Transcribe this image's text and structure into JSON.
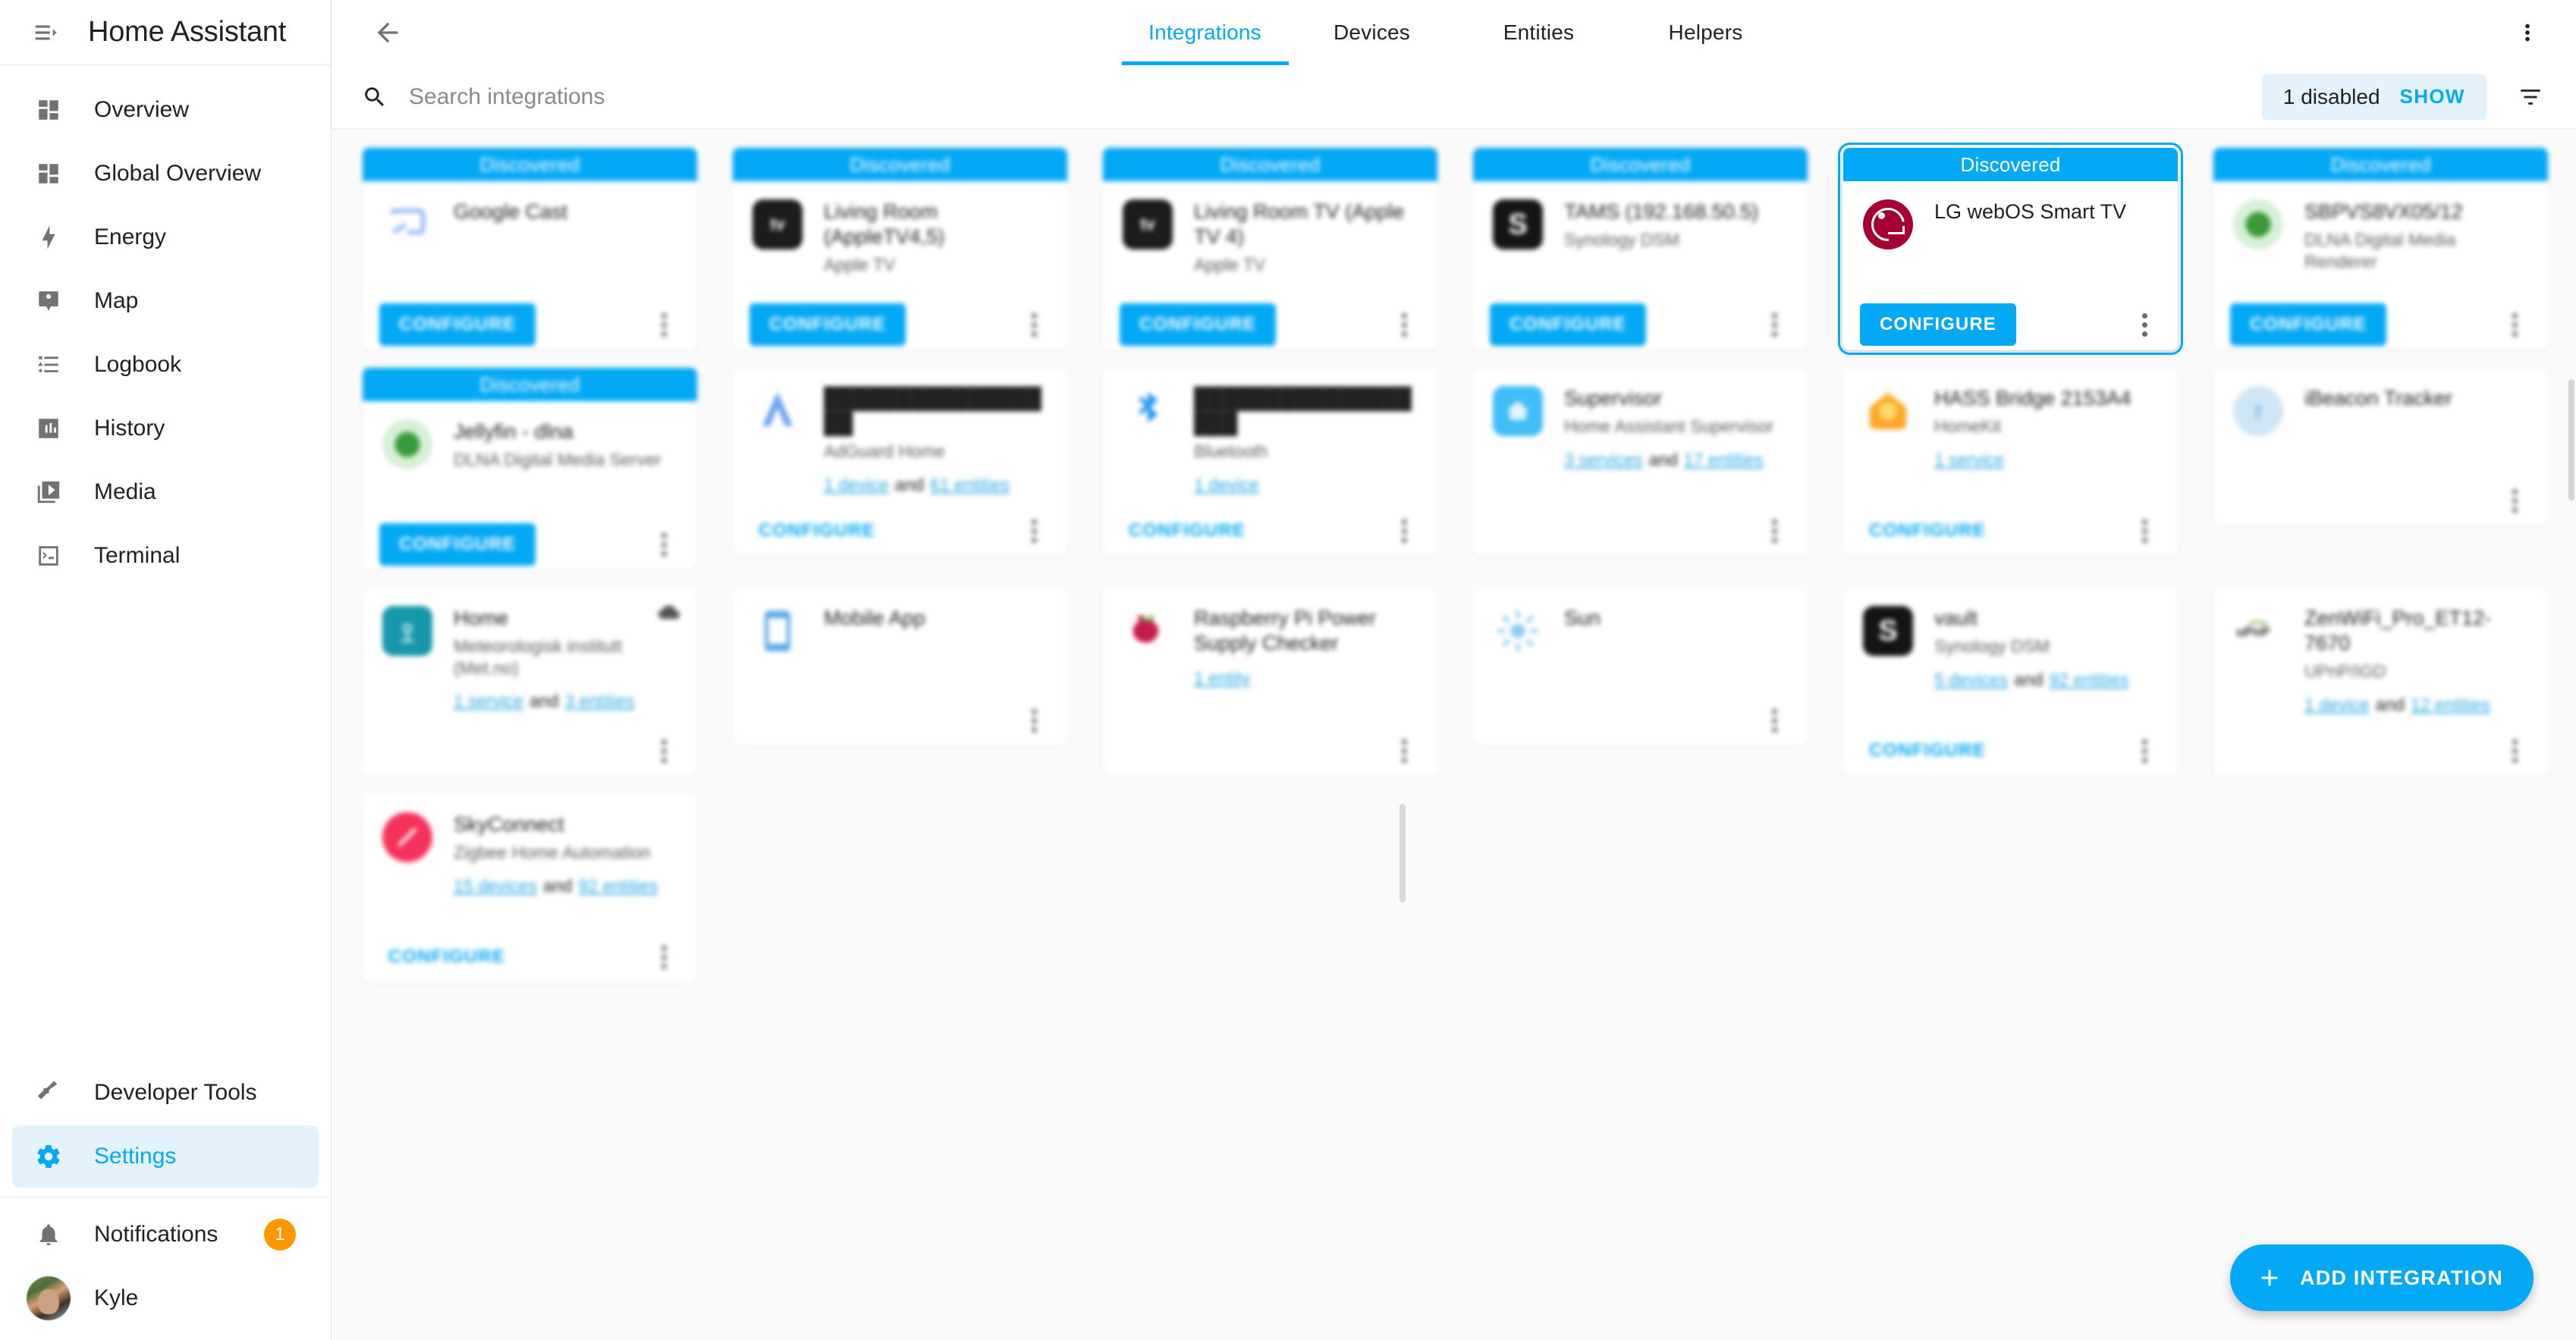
{
  "sidebar": {
    "title": "Home Assistant",
    "menu_icon": "menu-collapse-icon",
    "items": [
      {
        "label": "Overview",
        "icon": "dashboard-icon",
        "active": false
      },
      {
        "label": "Global Overview",
        "icon": "dashboard-icon",
        "active": false
      },
      {
        "label": "Energy",
        "icon": "lightning-bolt-icon",
        "active": false
      },
      {
        "label": "Map",
        "icon": "map-marker-account-icon",
        "active": false
      },
      {
        "label": "Logbook",
        "icon": "format-list-icon",
        "active": false
      },
      {
        "label": "History",
        "icon": "chart-box-icon",
        "active": false
      },
      {
        "label": "Media",
        "icon": "play-box-multiple-icon",
        "active": false
      },
      {
        "label": "Terminal",
        "icon": "console-icon",
        "active": false
      }
    ],
    "bottom_items": [
      {
        "label": "Developer Tools",
        "icon": "hammer-icon",
        "active": false
      },
      {
        "label": "Settings",
        "icon": "gear-icon",
        "active": true
      }
    ],
    "notifications": {
      "label": "Notifications",
      "icon": "bell-icon",
      "badge": "1"
    },
    "user": {
      "label": "Kyle",
      "icon": "avatar"
    }
  },
  "topbar": {
    "back_icon": "arrow-left-icon",
    "overflow_icon": "dots-vertical-icon",
    "tabs": [
      {
        "label": "Integrations",
        "active": true
      },
      {
        "label": "Devices",
        "active": false
      },
      {
        "label": "Entities",
        "active": false
      },
      {
        "label": "Helpers",
        "active": false
      }
    ]
  },
  "search": {
    "icon": "search-icon",
    "placeholder": "Search integrations",
    "value": "",
    "disabled_count_label": "1 disabled",
    "show_label": "SHOW",
    "filter_icon": "filter-variant-icon"
  },
  "labels": {
    "discovered": "Discovered",
    "configure": "CONFIGURE",
    "and": "and",
    "kebab_icon": "dots-vertical-icon",
    "cloud_icon": "cloud-icon"
  },
  "fab": {
    "label": "ADD INTEGRATION",
    "icon": "plus-icon"
  },
  "cards": [
    {
      "id": "google-cast",
      "discovered": true,
      "title": "Google Cast",
      "sub": "",
      "logo": "cast-icon",
      "logo_color": "#8ab4f8",
      "links": [],
      "configure": "CONFIGURE",
      "configure_style": "filled",
      "focused": false
    },
    {
      "id": "living-room-appletv-45",
      "discovered": true,
      "title": "Living Room (AppleTV4,5)",
      "sub": "Apple TV",
      "logo": "appletv-icon",
      "logo_color": "#1c1c1e",
      "links": [],
      "configure": "CONFIGURE",
      "configure_style": "filled",
      "focused": false
    },
    {
      "id": "living-room-tv-appletv-4",
      "discovered": true,
      "title": "Living Room TV (Apple TV 4)",
      "sub": "Apple TV",
      "logo": "appletv-icon",
      "logo_color": "#1c1c1e",
      "links": [],
      "configure": "CONFIGURE",
      "configure_style": "filled",
      "focused": false
    },
    {
      "id": "tams-synology",
      "discovered": true,
      "title": "TAMS (192.168.50.5)",
      "sub": "Synology DSM",
      "logo": "synology-icon",
      "logo_color": "#141414",
      "links": [],
      "configure": "CONFIGURE",
      "configure_style": "filled",
      "focused": false
    },
    {
      "id": "lg-webos-smart-tv",
      "discovered": true,
      "title": "LG webOS Smart TV",
      "sub": "",
      "logo": "lg-icon",
      "logo_color": "#a50034",
      "links": [],
      "configure": "CONFIGURE",
      "configure_style": "filled",
      "focused": true
    },
    {
      "id": "sbpvs8vx05-12",
      "discovered": true,
      "title": "SBPVS8VX05/12",
      "sub": "DLNA Digital Media Renderer",
      "logo": "dlna-icon",
      "logo_color": "#3a9b3a",
      "links": [],
      "configure": "CONFIGURE",
      "configure_style": "filled",
      "focused": false
    },
    {
      "id": "jellyfin-dlna",
      "discovered": true,
      "title": "Jellyfin - dlna",
      "sub": "DLNA Digital Media Server",
      "logo": "dlna-icon",
      "logo_color": "#3a9b3a",
      "links": [],
      "configure": "CONFIGURE",
      "configure_style": "filled",
      "focused": false
    },
    {
      "id": "adguard-home",
      "discovered": false,
      "title": "",
      "title_redacted": "█████████████████",
      "sub": "AdGuard Home",
      "logo": "adguard-icon",
      "logo_color": "#68a0f0",
      "links": [
        {
          "text": "1 device",
          "link": true
        },
        {
          "text": "and",
          "link": false
        },
        {
          "text": "61 entities",
          "link": true
        }
      ],
      "configure": "CONFIGURE",
      "configure_style": "flat",
      "focused": false
    },
    {
      "id": "bluetooth",
      "discovered": false,
      "title": "",
      "title_redacted": "██████████████████",
      "sub": "Bluetooth",
      "logo": "bluetooth-icon",
      "logo_color": "#2196f3",
      "links": [
        {
          "text": "1 device",
          "link": true
        }
      ],
      "configure": "CONFIGURE",
      "configure_style": "flat",
      "focused": false
    },
    {
      "id": "supervisor",
      "discovered": false,
      "title": "Supervisor",
      "sub": "Home Assistant Supervisor",
      "logo": "ha-supervisor-icon",
      "logo_color": "#41bdf5",
      "links": [
        {
          "text": "3 services",
          "link": true
        },
        {
          "text": "and",
          "link": false
        },
        {
          "text": "17 entities",
          "link": true
        }
      ],
      "configure": "",
      "configure_style": "none",
      "focused": false
    },
    {
      "id": "hass-bridge-2153a4",
      "discovered": false,
      "title": "HASS Bridge 2153A4",
      "sub": "HomeKit",
      "logo": "homekit-icon",
      "logo_color": "#ffa726",
      "links": [
        {
          "text": "1 service",
          "link": true
        }
      ],
      "configure": "CONFIGURE",
      "configure_style": "flat",
      "focused": false
    },
    {
      "id": "ibeacon-tracker",
      "discovered": false,
      "title": "iBeacon Tracker",
      "sub": "",
      "logo": "ibeacon-icon",
      "logo_color": "#cfe6f5",
      "links": [],
      "configure": "",
      "configure_style": "none",
      "focused": false
    },
    {
      "id": "home-metno",
      "discovered": false,
      "title": "Home",
      "sub": "Meteorologisk institutt (Met.no)",
      "logo": "metno-icon",
      "logo_color": "#1797ab",
      "links": [
        {
          "text": "1 service",
          "link": true
        },
        {
          "text": "and",
          "link": false
        },
        {
          "text": "3 entities",
          "link": true
        }
      ],
      "configure": "",
      "configure_style": "none",
      "cloud": true,
      "focused": false
    },
    {
      "id": "mobile-app",
      "discovered": false,
      "title": "Mobile App",
      "sub": "",
      "logo": "cellphone-icon",
      "logo_color": "#5aa7e8",
      "links": [],
      "configure": "",
      "configure_style": "none",
      "focused": false
    },
    {
      "id": "rpi-power-supply-checker",
      "discovered": false,
      "title": "Raspberry Pi Power Supply Checker",
      "sub": "",
      "logo": "raspberry-pi-icon",
      "logo_color": "#c51a4a",
      "links": [
        {
          "text": "1 entity",
          "link": true
        }
      ],
      "configure": "",
      "configure_style": "none",
      "focused": false
    },
    {
      "id": "sun",
      "discovered": false,
      "title": "Sun",
      "sub": "",
      "logo": "sun-icon",
      "logo_color": "#8ecdf0",
      "links": [],
      "configure": "",
      "configure_style": "none",
      "focused": false
    },
    {
      "id": "vault-synology",
      "discovered": false,
      "title": "vault",
      "sub": "Synology DSM",
      "logo": "synology-icon",
      "logo_color": "#141414",
      "links": [
        {
          "text": "5 devices",
          "link": true
        },
        {
          "text": "and",
          "link": false
        },
        {
          "text": "92 entities",
          "link": true
        }
      ],
      "configure": "CONFIGURE",
      "configure_style": "flat",
      "focused": false
    },
    {
      "id": "zenwifi-pro-et12",
      "discovered": false,
      "title": "ZenWiFi_Pro_ET12-7670",
      "sub": "UPnP/IGD",
      "logo": "upnp-icon",
      "logo_color": "#7ab648",
      "links": [
        {
          "text": "1 device",
          "link": true
        },
        {
          "text": "and",
          "link": false
        },
        {
          "text": "12 entities",
          "link": true
        }
      ],
      "configure": "",
      "configure_style": "none",
      "focused": false
    },
    {
      "id": "skyconnect-zha",
      "discovered": false,
      "title": "SkyConnect",
      "sub": "Zigbee Home Automation",
      "logo": "skyconnect-icon",
      "logo_color": "#f5325b",
      "links": [
        {
          "text": "15 devices",
          "link": true
        },
        {
          "text": "and",
          "link": false
        },
        {
          "text": "92 entities",
          "link": true
        }
      ],
      "configure": "CONFIGURE",
      "configure_style": "flat",
      "focused": false
    }
  ]
}
